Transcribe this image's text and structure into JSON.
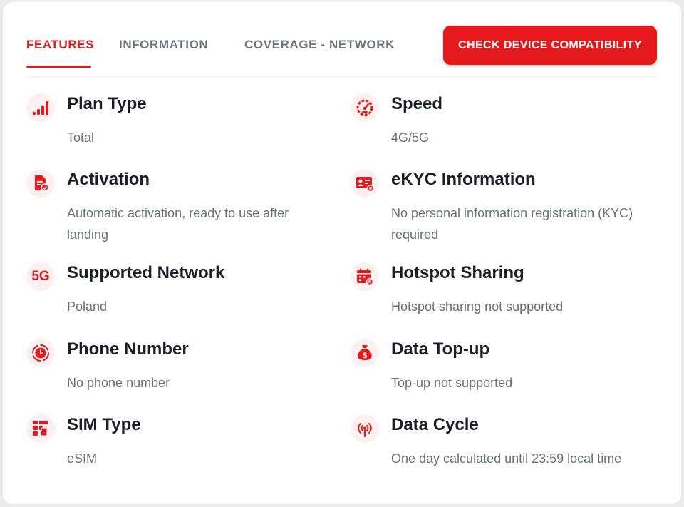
{
  "tabs": [
    {
      "label": "FEATURES",
      "active": true
    },
    {
      "label": "INFORMATION",
      "active": false
    },
    {
      "label": "COVERAGE - NETWORK",
      "active": false
    }
  ],
  "cta_label": "CHECK DEVICE COMPATIBILITY",
  "accent_color": "#e3191c",
  "features": [
    {
      "icon": "signal-bars-icon",
      "title": "Plan Type",
      "value": "Total"
    },
    {
      "icon": "speedometer-icon",
      "title": "Speed",
      "value": "4G/5G"
    },
    {
      "icon": "document-check-icon",
      "title": "Activation",
      "value": "Automatic activation, ready to use after landing"
    },
    {
      "icon": "id-card-icon",
      "title": "eKYC Information",
      "value": "No personal information registration (KYC) required"
    },
    {
      "icon": "5g-icon",
      "title": "Supported Network",
      "value": "Poland",
      "icon_text": "5G"
    },
    {
      "icon": "hotspot-calendar-icon",
      "title": "Hotspot Sharing",
      "value": "Hotspot sharing not supported"
    },
    {
      "icon": "clock-icon",
      "title": "Phone Number",
      "value": "No phone number"
    },
    {
      "icon": "money-bag-icon",
      "title": "Data Top-up",
      "value": "Top-up not supported",
      "icon_text": "$"
    },
    {
      "icon": "sim-card-icon",
      "title": "SIM Type",
      "value": "eSIM"
    },
    {
      "icon": "antenna-icon",
      "title": "Data Cycle",
      "value": "One day calculated until 23:59 local time"
    }
  ]
}
